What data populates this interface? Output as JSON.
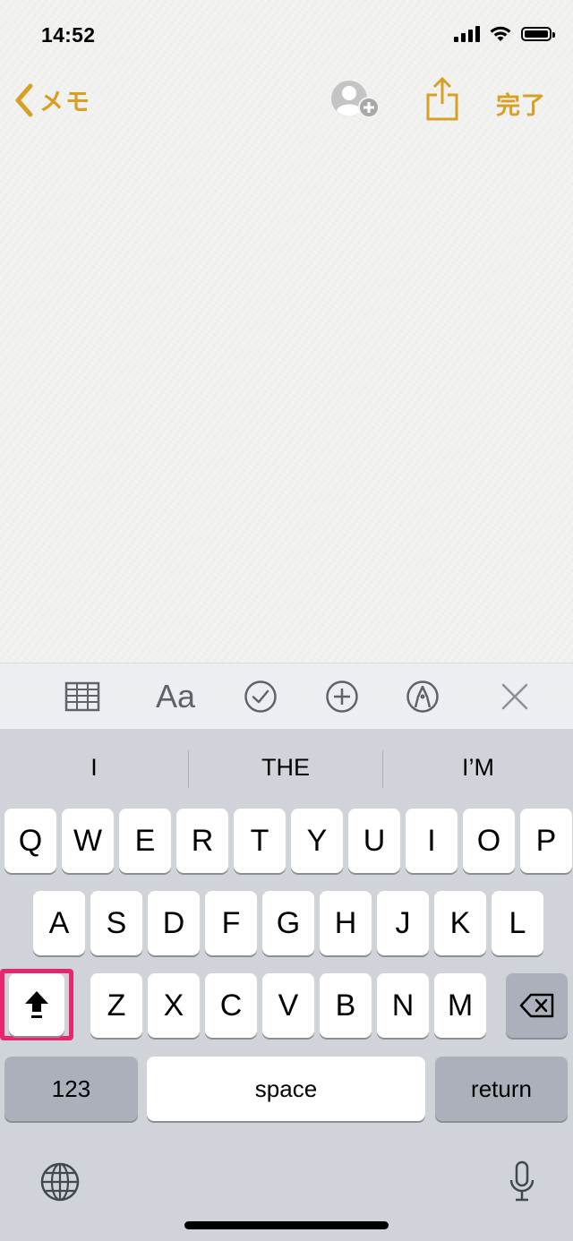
{
  "status_bar": {
    "time": "14:52"
  },
  "nav": {
    "back_label": "メモ",
    "done_label": "完了"
  },
  "toolbar": {
    "format_label": "Aa"
  },
  "keyboard": {
    "suggestions": [
      "I",
      "THE",
      "I’M"
    ],
    "row1": [
      "Q",
      "W",
      "E",
      "R",
      "T",
      "Y",
      "U",
      "I",
      "O",
      "P"
    ],
    "row2": [
      "A",
      "S",
      "D",
      "F",
      "G",
      "H",
      "J",
      "K",
      "L"
    ],
    "row3": [
      "Z",
      "X",
      "C",
      "V",
      "B",
      "N",
      "M"
    ],
    "numbers_label": "123",
    "space_label": "space",
    "return_label": "return"
  },
  "colors": {
    "accent": "#d8a023",
    "highlight": "#e8266e"
  }
}
